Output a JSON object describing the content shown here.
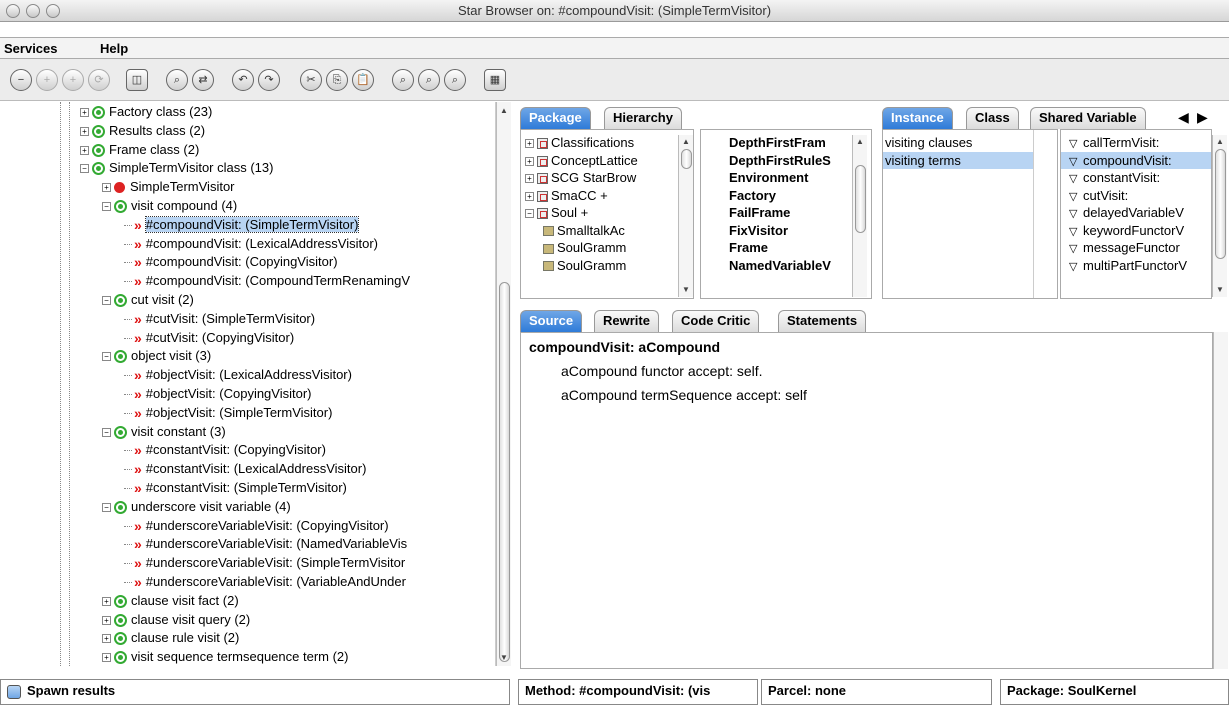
{
  "window": {
    "title": "Star Browser on: #compoundVisit: (SimpleTermVisitor)"
  },
  "menu": [
    "Services",
    "Help"
  ],
  "toolbar_icons": [
    "remove-icon",
    "add-icon",
    "add-alt-icon",
    "refresh-icon",
    "split-view-icon",
    "find-icon",
    "search-replace-icon",
    "undo-icon",
    "redo-icon",
    "cut-icon",
    "copy-icon",
    "paste-icon",
    "find-selector-icon",
    "find-senders-icon",
    "find-implementors-icon",
    "calculator-icon"
  ],
  "tree": [
    {
      "level": 1,
      "kind": "category",
      "expanded": false,
      "label": "Factory class (23)"
    },
    {
      "level": 1,
      "kind": "category",
      "expanded": false,
      "label": "Results class (2)"
    },
    {
      "level": 1,
      "kind": "category",
      "expanded": false,
      "label": "Frame class (2)"
    },
    {
      "level": 1,
      "kind": "category",
      "expanded": true,
      "label": "SimpleTermVisitor class (13)"
    },
    {
      "level": 2,
      "kind": "class",
      "expanded": false,
      "label": "SimpleTermVisitor"
    },
    {
      "level": 2,
      "kind": "category",
      "expanded": true,
      "label": "visit compound (4)"
    },
    {
      "level": 3,
      "kind": "method",
      "label": "#compoundVisit: (SimpleTermVisitor)",
      "selected": true
    },
    {
      "level": 3,
      "kind": "method",
      "label": "#compoundVisit: (LexicalAddressVisitor)"
    },
    {
      "level": 3,
      "kind": "method",
      "label": "#compoundVisit: (CopyingVisitor)"
    },
    {
      "level": 3,
      "kind": "method",
      "label": "#compoundVisit: (CompoundTermRenamingV"
    },
    {
      "level": 2,
      "kind": "category",
      "expanded": true,
      "label": "cut visit (2)"
    },
    {
      "level": 3,
      "kind": "method",
      "label": "#cutVisit: (SimpleTermVisitor)"
    },
    {
      "level": 3,
      "kind": "method",
      "label": "#cutVisit: (CopyingVisitor)"
    },
    {
      "level": 2,
      "kind": "category",
      "expanded": true,
      "label": "object visit (3)"
    },
    {
      "level": 3,
      "kind": "method",
      "label": "#objectVisit: (LexicalAddressVisitor)"
    },
    {
      "level": 3,
      "kind": "method",
      "label": "#objectVisit: (CopyingVisitor)"
    },
    {
      "level": 3,
      "kind": "method",
      "label": "#objectVisit: (SimpleTermVisitor)"
    },
    {
      "level": 2,
      "kind": "category",
      "expanded": true,
      "label": "visit constant (3)"
    },
    {
      "level": 3,
      "kind": "method",
      "label": "#constantVisit: (CopyingVisitor)"
    },
    {
      "level": 3,
      "kind": "method",
      "label": "#constantVisit: (LexicalAddressVisitor)"
    },
    {
      "level": 3,
      "kind": "method",
      "label": "#constantVisit: (SimpleTermVisitor)"
    },
    {
      "level": 2,
      "kind": "category",
      "expanded": true,
      "label": "underscore visit variable (4)"
    },
    {
      "level": 3,
      "kind": "method",
      "label": "#underscoreVariableVisit: (CopyingVisitor)"
    },
    {
      "level": 3,
      "kind": "method",
      "label": "#underscoreVariableVisit: (NamedVariableVis"
    },
    {
      "level": 3,
      "kind": "method",
      "label": "#underscoreVariableVisit: (SimpleTermVisitor"
    },
    {
      "level": 3,
      "kind": "method",
      "label": "#underscoreVariableVisit: (VariableAndUnder"
    },
    {
      "level": 2,
      "kind": "category",
      "expanded": false,
      "label": "clause visit fact (2)"
    },
    {
      "level": 2,
      "kind": "category",
      "expanded": false,
      "label": "clause visit query (2)"
    },
    {
      "level": 2,
      "kind": "category",
      "expanded": false,
      "label": "clause rule visit (2)"
    },
    {
      "level": 2,
      "kind": "category",
      "expanded": false,
      "label": "visit sequence termsequence term (2)"
    }
  ],
  "left_tabs": [
    "Package",
    "Hierarchy"
  ],
  "packages": [
    {
      "sign": "+",
      "icon": "pkg",
      "label": "Classifications",
      "indent": 0
    },
    {
      "sign": "+",
      "icon": "pkg",
      "label": "ConceptLattice",
      "indent": 0
    },
    {
      "sign": "+",
      "icon": "pkg",
      "label": "SCG StarBrow",
      "indent": 0
    },
    {
      "sign": "+",
      "icon": "pkg",
      "label": "SmaCC +",
      "indent": 0
    },
    {
      "sign": "-",
      "icon": "pkg",
      "label": "Soul +",
      "indent": 0
    },
    {
      "sign": "",
      "icon": "cube",
      "label": "SmalltalkAc",
      "indent": 1
    },
    {
      "sign": "",
      "icon": "cube",
      "label": "SoulGramm",
      "indent": 1
    },
    {
      "sign": "",
      "icon": "cube",
      "label": "SoulGramm",
      "indent": 1
    }
  ],
  "classes": [
    "DepthFirstFram",
    "DepthFirstRuleS",
    "Environment",
    "Factory",
    "FailFrame",
    "FixVisitor",
    "Frame",
    "NamedVariableV"
  ],
  "right_tabs": [
    "Instance",
    "Class",
    "Shared Variable"
  ],
  "protocols": [
    "visiting clauses",
    "visiting terms"
  ],
  "methods": [
    "callTermVisit:",
    "compoundVisit:",
    "constantVisit:",
    "cutVisit:",
    "delayedVariableV",
    "keywordFunctorV",
    "messageFunctor",
    "multiPartFunctorV"
  ],
  "code_tabs": [
    "Source",
    "Rewrite",
    "Code Critic",
    "Statements"
  ],
  "source": {
    "signature": "compoundVisit: aCompound",
    "line1": "aCompound functor accept: self.",
    "line2": "aCompound termSequence accept: self"
  },
  "status": {
    "spawn": "Spawn results",
    "method": "Method: #compoundVisit: (vis",
    "parcel": "Parcel: none",
    "package": "Package: SoulKernel"
  },
  "colors": {
    "tab_active": "#2e7bd8",
    "selection": "#b8d4f3",
    "category_icon": "#33aa33",
    "method_icon": "#dd1111"
  }
}
